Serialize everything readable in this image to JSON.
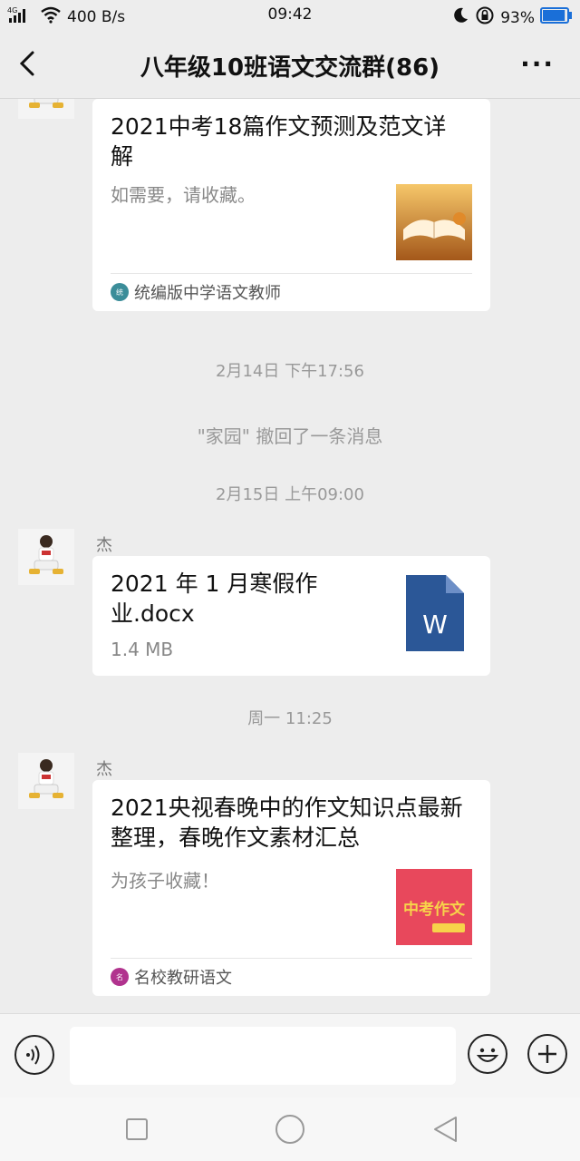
{
  "status_bar": {
    "network": "4G",
    "speed": "400 B/s",
    "time": "09:42",
    "battery": "93%",
    "battery_level": 0.93
  },
  "header": {
    "title": "八年级10班语文交流群(86)",
    "more": "···"
  },
  "messages": [
    {
      "type": "article",
      "title": "2021中考18篇作文预测及范文详解",
      "description": "如需要，请收藏。",
      "source": "统编版中学语文教师",
      "source_icon": "source-logo-teacher"
    },
    {
      "type": "time",
      "text": "2月14日 下午17:56"
    },
    {
      "type": "system",
      "text": "\"家园\" 撤回了一条消息"
    },
    {
      "type": "time",
      "text": "2月15日 上午09:00"
    },
    {
      "type": "file",
      "sender": "杰",
      "file_name": "2021 年 1 月寒假作业.docx",
      "file_size": "1.4 MB",
      "file_icon": "word-doc-icon",
      "file_icon_letter": "W"
    },
    {
      "type": "time",
      "text": "周一 11:25"
    },
    {
      "type": "article",
      "sender": "杰",
      "title": "2021央视春晚中的作文知识点最新整理，春晚作文素材汇总",
      "description": "为孩子收藏！",
      "source": "名校教研语文",
      "source_icon": "source-logo-school",
      "thumb_text": "中考作文"
    }
  ],
  "colors": {
    "background": "#ededed",
    "card": "#ffffff",
    "word_blue": "#2b5797",
    "thumb_red": "#e8485c"
  }
}
